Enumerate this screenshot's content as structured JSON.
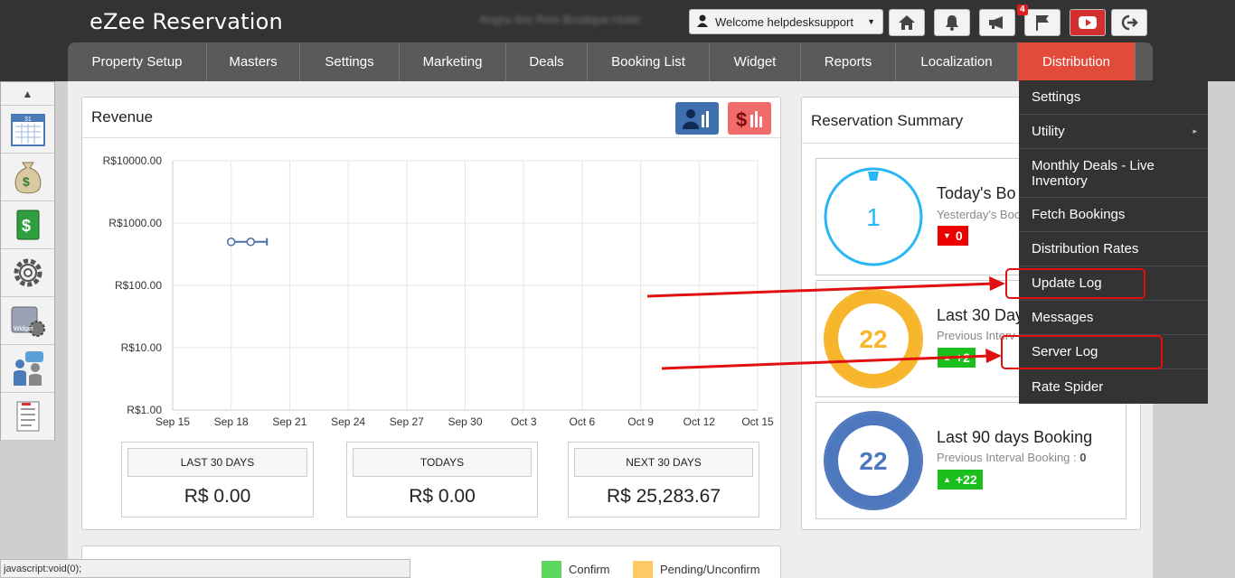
{
  "app": {
    "title": "eZee Reservation",
    "hotel_name": "Angra dos Reis Boutique Hotel"
  },
  "header": {
    "welcome": "Welcome helpdesksupport",
    "notification_count": "4",
    "icons": [
      "home-icon",
      "bell-icon",
      "megaphone-icon",
      "flag-icon",
      "youtube-icon",
      "logout-icon"
    ]
  },
  "nav": {
    "items": [
      {
        "label": "Property Setup"
      },
      {
        "label": "Masters"
      },
      {
        "label": "Settings"
      },
      {
        "label": "Marketing"
      },
      {
        "label": "Deals"
      },
      {
        "label": "Booking List"
      },
      {
        "label": "Widget"
      },
      {
        "label": "Reports"
      },
      {
        "label": "Localization"
      },
      {
        "label": "Distribution",
        "active": true
      }
    ]
  },
  "dropdown": {
    "items": [
      {
        "label": "Settings"
      },
      {
        "label": "Utility",
        "submenu": true
      },
      {
        "label": "Monthly Deals - Live Inventory"
      },
      {
        "label": "Fetch Bookings"
      },
      {
        "label": "Distribution Rates"
      },
      {
        "label": "Update Log"
      },
      {
        "label": "Messages"
      },
      {
        "label": "Server Log"
      },
      {
        "label": "Rate Spider"
      }
    ]
  },
  "sidebar": {
    "icons": [
      "calendar-icon",
      "money-bag-icon",
      "cash-icon",
      "gear-icon",
      "widget-icon",
      "users-icon",
      "task-list-icon"
    ],
    "calendar_day": "31",
    "widget_label": "Widget"
  },
  "revenue": {
    "title": "Revenue",
    "stats": [
      {
        "label": "LAST 30 DAYS",
        "value": "R$ 0.00"
      },
      {
        "label": "TODAYS",
        "value": "R$ 0.00"
      },
      {
        "label": "NEXT 30 DAYS",
        "value": "R$ 25,283.67"
      }
    ]
  },
  "chart_data": {
    "type": "line",
    "yscale": "log",
    "ylim": [
      1,
      10000
    ],
    "y_ticks": [
      "R$1.00",
      "R$10.00",
      "R$100.00",
      "R$1000.00",
      "R$10000.00"
    ],
    "x_ticks": [
      "Sep 15",
      "Sep 18",
      "Sep 21",
      "Sep 24",
      "Sep 27",
      "Sep 30",
      "Oct 3",
      "Oct 6",
      "Oct 9",
      "Oct 12",
      "Oct 15"
    ],
    "series": [
      {
        "x": [
          "Sep 18",
          "Sep 19"
        ],
        "values": [
          500,
          500
        ]
      }
    ],
    "grid": true
  },
  "summary": {
    "title": "Reservation Summary",
    "cards": [
      {
        "count": "1",
        "title": "Today's Bo",
        "subtitle": "Yesterday's Boo",
        "delta": "0",
        "color": "#29b6f6"
      },
      {
        "count": "22",
        "title": "Last 30 Day",
        "subtitle": "Previous Interv",
        "delta": "+2",
        "color": "#f7b52c"
      },
      {
        "count": "22",
        "title": "Last 90 days Booking",
        "subtitle": "Previous Interval Booking : ",
        "subtitle_value": "0",
        "delta": "+22",
        "color": "#4d78be"
      }
    ]
  },
  "legend": {
    "confirm": "Confirm",
    "pending": "Pending/Unconfirm",
    "confirm_color": "#5cd65c",
    "pending_color": "#ffc966"
  },
  "status_bar": "javascript:void(0);"
}
